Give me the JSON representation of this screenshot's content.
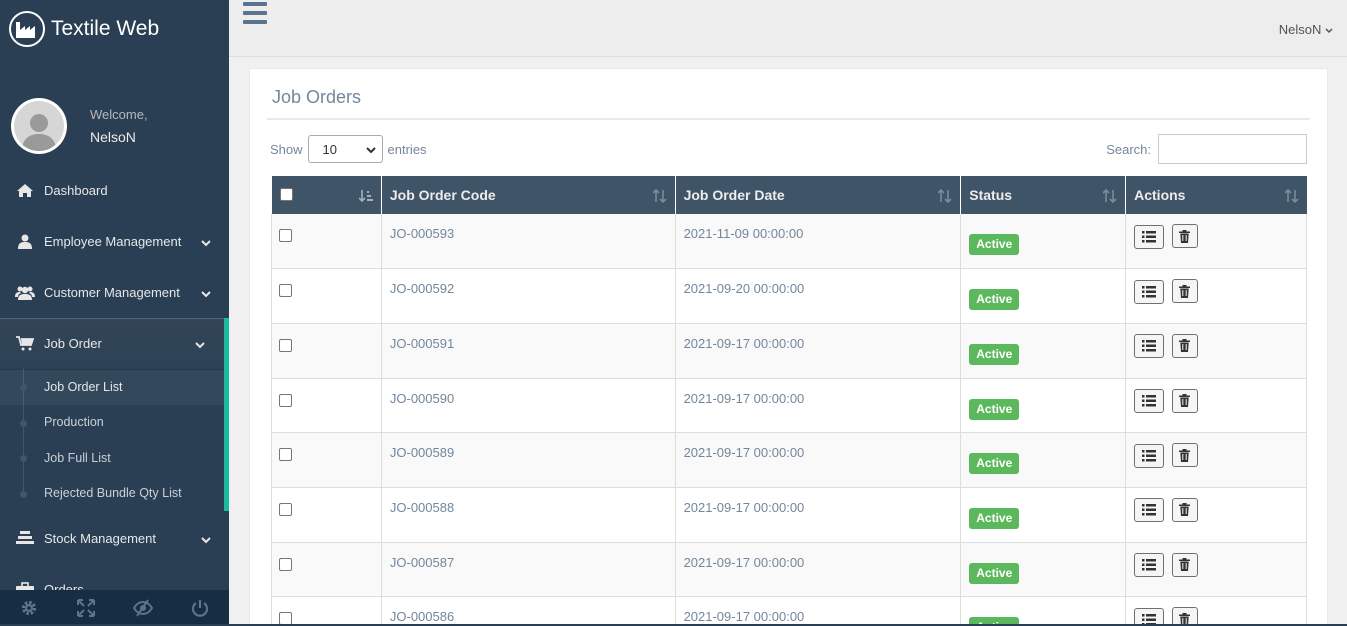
{
  "app": {
    "title": "Textile Web"
  },
  "profile": {
    "welcome": "Welcome,",
    "name": "NelsoN"
  },
  "sidebar": {
    "items": [
      {
        "label": "Dashboard",
        "icon": "home-icon",
        "has_children": false
      },
      {
        "label": "Employee Management",
        "icon": "user-icon",
        "has_children": true
      },
      {
        "label": "Customer Management",
        "icon": "users-icon",
        "has_children": true
      },
      {
        "label": "Job Order",
        "icon": "cart-icon",
        "has_children": true,
        "active": true
      },
      {
        "label": "Stock Management",
        "icon": "stack-icon",
        "has_children": true
      },
      {
        "label": "Orders",
        "icon": "briefcase-icon",
        "has_children": true
      }
    ],
    "job_order_sub": [
      {
        "label": "Job Order List",
        "current": true
      },
      {
        "label": "Production"
      },
      {
        "label": "Job Full List"
      },
      {
        "label": "Rejected Bundle Qty List"
      }
    ],
    "footer_icons": [
      "settings-icon",
      "fullscreen-icon",
      "lock-icon",
      "logout-icon"
    ]
  },
  "topnav": {
    "user_label": "NelsoN"
  },
  "panel": {
    "title": "Job Orders",
    "show_label": "Show",
    "entries_value": "10",
    "entries_label": "entries",
    "search_label": "Search:",
    "search_value": ""
  },
  "table": {
    "columns": [
      "",
      "Job Order Code",
      "Job Order Date",
      "Status",
      "Actions"
    ],
    "rows": [
      {
        "code": "JO-000593",
        "date": "2021-11-09 00:00:00",
        "status": "Active"
      },
      {
        "code": "JO-000592",
        "date": "2021-09-20 00:00:00",
        "status": "Active"
      },
      {
        "code": "JO-000591",
        "date": "2021-09-17 00:00:00",
        "status": "Active"
      },
      {
        "code": "JO-000590",
        "date": "2021-09-17 00:00:00",
        "status": "Active"
      },
      {
        "code": "JO-000589",
        "date": "2021-09-17 00:00:00",
        "status": "Active"
      },
      {
        "code": "JO-000588",
        "date": "2021-09-17 00:00:00",
        "status": "Active"
      },
      {
        "code": "JO-000587",
        "date": "2021-09-17 00:00:00",
        "status": "Active"
      },
      {
        "code": "JO-000586",
        "date": "2021-09-17 00:00:00",
        "status": "Active"
      }
    ]
  },
  "colors": {
    "sidebar_bg": "#2a3f54",
    "accent": "#1abb9c",
    "header_bg": "#405467",
    "badge_green": "#5cb85c"
  }
}
